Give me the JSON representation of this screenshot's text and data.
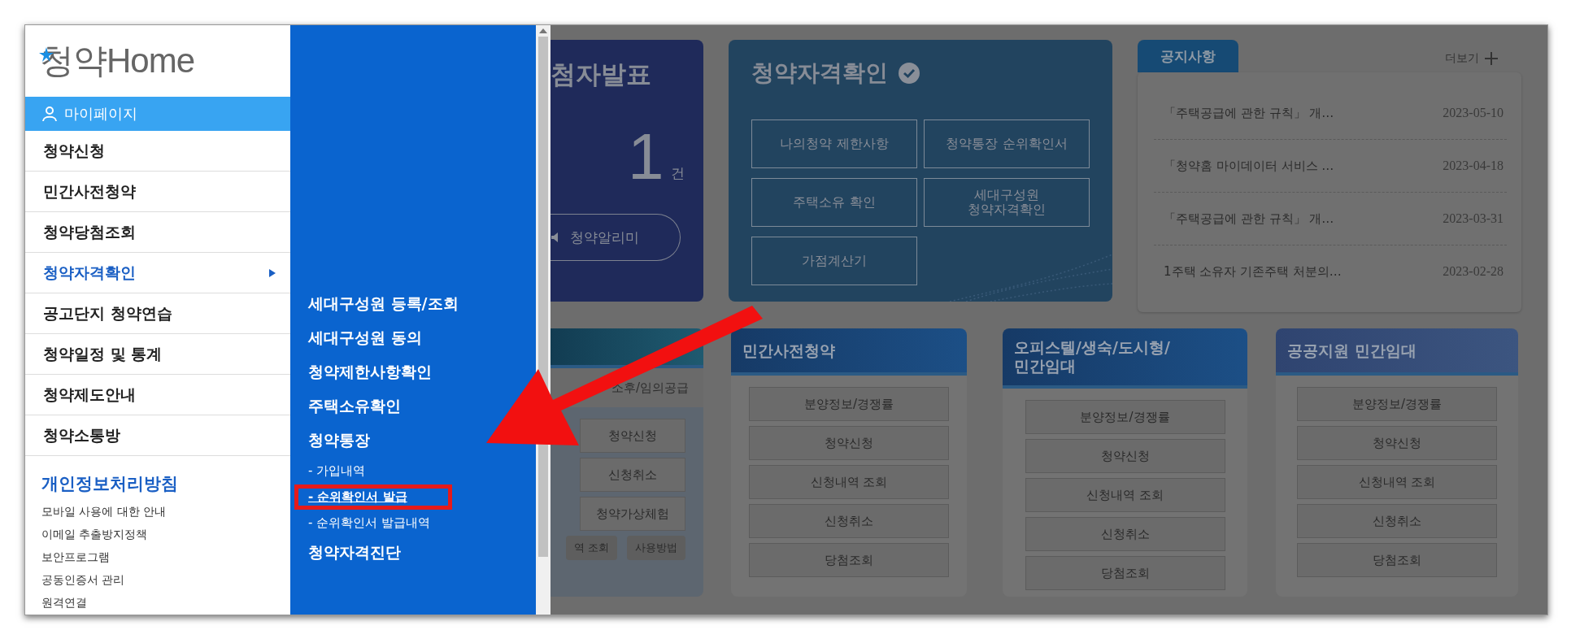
{
  "logo": {
    "text": "청약Home"
  },
  "sidebar": {
    "header": {
      "label": "마이페이지"
    },
    "items": [
      {
        "label": "청약신청",
        "selected": false
      },
      {
        "label": "민간사전청약",
        "selected": false
      },
      {
        "label": "청약당첨조회",
        "selected": false
      },
      {
        "label": "청약자격확인",
        "selected": true
      },
      {
        "label": "공고단지 청약연습",
        "selected": false
      },
      {
        "label": "청약일정 및 통계",
        "selected": false
      },
      {
        "label": "청약제도안내",
        "selected": false
      },
      {
        "label": "청약소통방",
        "selected": false
      }
    ],
    "policy": {
      "title": "개인정보처리방침",
      "links": [
        "모바일 사용에 대한 안내",
        "이메일 추출방지정책",
        "보안프로그램",
        "공동인증서 관리",
        "원격연결"
      ]
    }
  },
  "submenu": {
    "items": [
      {
        "label": "세대구성원 등록/조회",
        "kind": "main",
        "highlighted": false
      },
      {
        "label": "세대구성원 동의",
        "kind": "main",
        "highlighted": false
      },
      {
        "label": "청약제한사항확인",
        "kind": "main",
        "highlighted": false
      },
      {
        "label": "주택소유확인",
        "kind": "main",
        "highlighted": false
      },
      {
        "label": "청약통장",
        "kind": "main",
        "highlighted": false
      },
      {
        "label": "- 가입내역",
        "kind": "sub",
        "highlighted": false
      },
      {
        "label": "- 순위확인서 발급",
        "kind": "sub",
        "highlighted": true
      },
      {
        "label": "- 순위확인서 발급내역",
        "kind": "sub",
        "highlighted": false
      },
      {
        "label": "청약자격진단",
        "kind": "main",
        "highlighted": false
      }
    ]
  },
  "announce_card": {
    "title": "첨자발표",
    "count": "1",
    "unit": "건",
    "button": "청약알리미"
  },
  "eligibility_card": {
    "title": "청약자격확인",
    "buttons": [
      "나의청약 제한사항",
      "청약통장 순위확인서",
      "주택소유 확인",
      "세대구성원\n청약자격확인",
      "가점계산기"
    ]
  },
  "notice": {
    "tab": "공지사항",
    "more": "더보기",
    "items": [
      {
        "title": "「주택공급에 관한 규칙」 개…",
        "date": "2023-05-10"
      },
      {
        "title": "「청약홈 마이데이터 서비스 …",
        "date": "2023-04-18"
      },
      {
        "title": "「주택공급에 관한 규칙」 개…",
        "date": "2023-03-31"
      },
      {
        "title": "1주택 소유자 기존주택 처분의…",
        "date": "2023-02-28"
      }
    ]
  },
  "service_cards": [
    {
      "kind": "partial",
      "subtitle": "소후/임의공급",
      "buttons": [
        "청약신청",
        "신청취소",
        "청약가상체험"
      ],
      "small_buttons": [
        "역 조회",
        "사용방법"
      ]
    },
    {
      "kind": "full",
      "title": "민간사전청약",
      "buttons": [
        "분양정보/경쟁률",
        "청약신청",
        "신청내역 조회",
        "신청취소",
        "당첨조회"
      ]
    },
    {
      "kind": "full",
      "title": "오피스텔/생숙/도시형/\n민간임대",
      "buttons": [
        "분양정보/경쟁률",
        "청약신청",
        "신청내역 조회",
        "신청취소",
        "당첨조회"
      ]
    },
    {
      "kind": "full",
      "title": "공공지원 민간임대",
      "buttons": [
        "분양정보/경쟁률",
        "청약신청",
        "신청내역 조회",
        "신청취소",
        "당첨조회"
      ]
    }
  ]
}
